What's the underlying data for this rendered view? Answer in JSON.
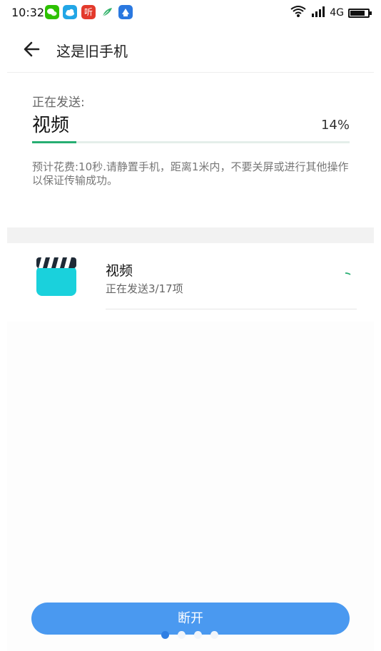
{
  "status_bar": {
    "time": "10:32",
    "notifications": [
      "wechat-icon",
      "weather-icon",
      "ting-icon",
      "leaf-icon",
      "app-icon"
    ],
    "ting_label": "听",
    "network": "4G",
    "battery_level": 0.85
  },
  "header": {
    "title": "这是旧手机"
  },
  "sending": {
    "label": "正在发送:",
    "item": "视频",
    "percent_text": "14%",
    "progress": 0.14,
    "notice": "预计花费:10秒.请静置手机，距离1米内，不要关屏或进行其他操作以保证传输成功。"
  },
  "list": {
    "items": [
      {
        "name": "视频",
        "status": "正在发送3/17项",
        "icon": "video-clapper-icon"
      }
    ]
  },
  "footer": {
    "disconnect_label": "断开",
    "page_dots": 4,
    "active_dot": 0
  },
  "colors": {
    "accent_blue": "#4a99f0",
    "progress_green": "#27ae72",
    "icon_teal": "#1ad1dc"
  }
}
